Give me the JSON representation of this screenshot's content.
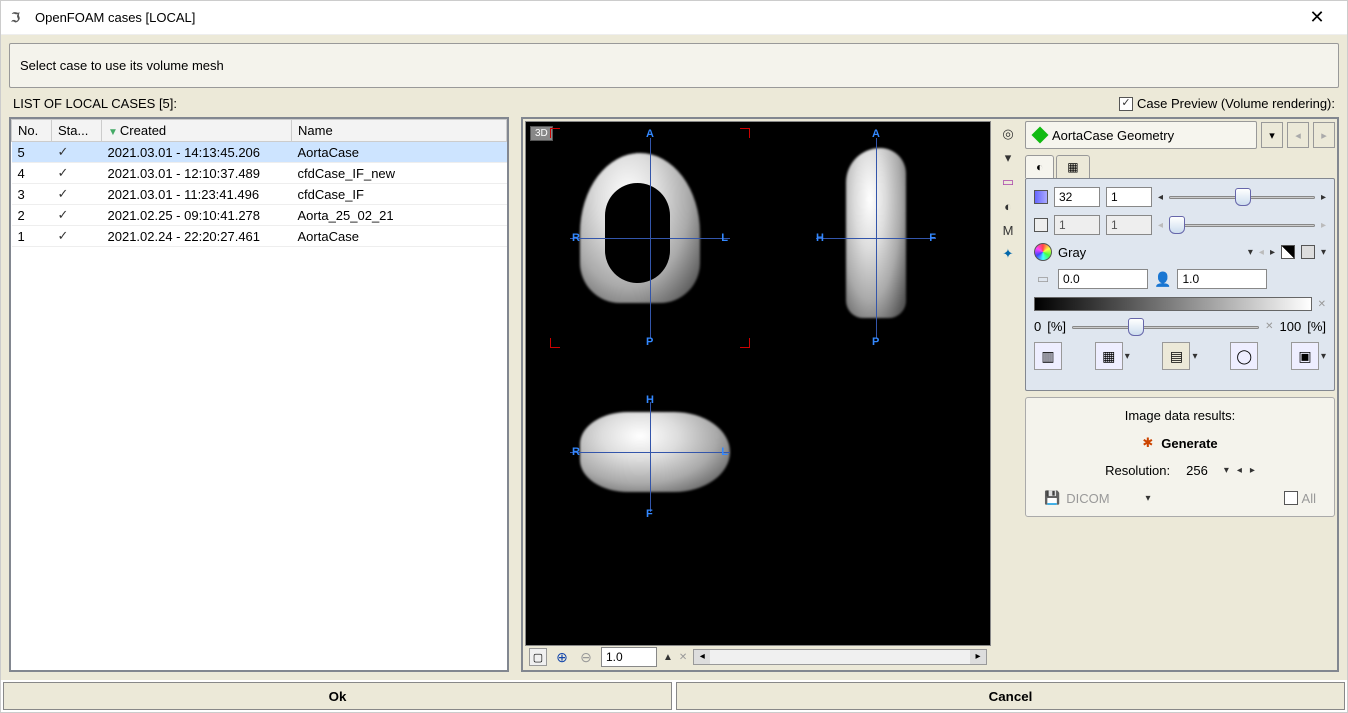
{
  "window": {
    "title": "OpenFOAM cases [LOCAL]"
  },
  "banner": "Select case to use its volume mesh",
  "list_label": "LIST OF LOCAL CASES [5]:",
  "preview_checkbox": {
    "checked": true,
    "label": "Case Preview (Volume rendering):"
  },
  "table": {
    "headers": {
      "no": "No.",
      "status": "Sta...",
      "created": "Created",
      "name": "Name"
    },
    "rows": [
      {
        "no": "5",
        "status": "✓",
        "created": "2021.03.01 - 14:13:45.206",
        "name": "AortaCase",
        "selected": true
      },
      {
        "no": "4",
        "status": "✓",
        "created": "2021.03.01 - 12:10:37.489",
        "name": "cfdCase_IF_new",
        "selected": false
      },
      {
        "no": "3",
        "status": "✓",
        "created": "2021.03.01 - 11:23:41.496",
        "name": "cfdCase_IF",
        "selected": false
      },
      {
        "no": "2",
        "status": "✓",
        "created": "2021.02.25 - 09:10:41.278",
        "name": "Aorta_25_02_21",
        "selected": false
      },
      {
        "no": "1",
        "status": "✓",
        "created": "2021.02.24 - 22:20:27.461",
        "name": "AortaCase",
        "selected": false
      }
    ]
  },
  "viewer": {
    "badge": "3D",
    "labels": {
      "A": "A",
      "P": "P",
      "R": "R",
      "L": "L",
      "H": "H",
      "F": "F"
    },
    "zoom": "1.0"
  },
  "geometry": {
    "label": "AortaCase Geometry"
  },
  "controls": {
    "range1_a": "32",
    "range1_b": "1",
    "range2_a": "1",
    "range2_b": "1",
    "colormap": "Gray",
    "opacity_a": "0.0",
    "opacity_b": "1.0",
    "pct_left_val": "0",
    "pct_right_val": "100",
    "pct_unit": "[%]"
  },
  "results": {
    "title": "Image data results:",
    "generate": "Generate",
    "res_label": "Resolution:",
    "res_value": "256",
    "dicom": "DICOM",
    "all": "All"
  },
  "footer": {
    "ok": "Ok",
    "cancel": "Cancel"
  }
}
